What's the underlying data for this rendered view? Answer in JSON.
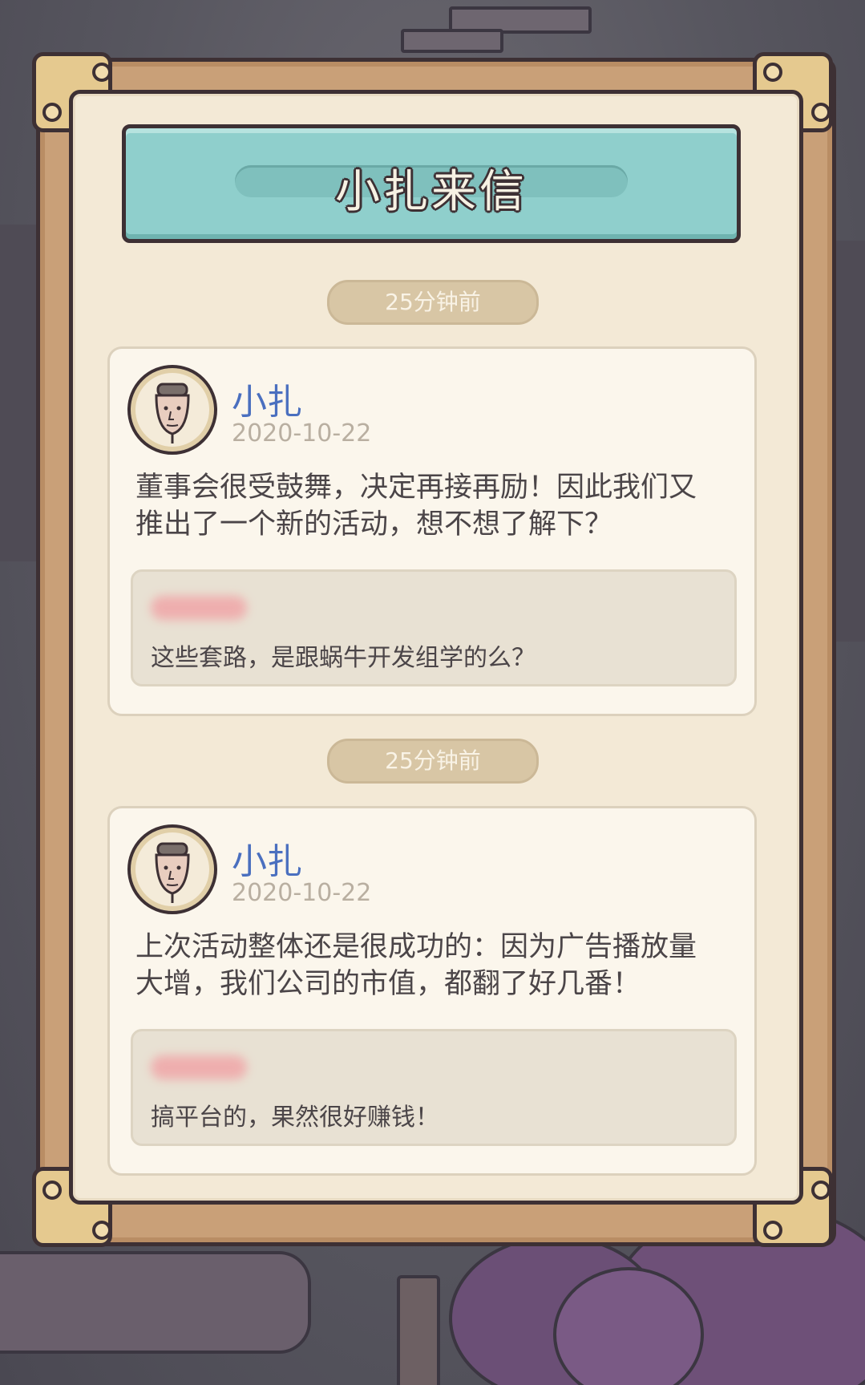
{
  "window": {
    "title": "小扎来信"
  },
  "messages": [
    {
      "time_label": "25分钟前",
      "sender": "小扎",
      "date": "2020-10-22",
      "body_line1": "董事会很受鼓舞，决定再接再励！因此我们又",
      "body_line2": "推出了一个新的活动，想不想了解下？",
      "reply": "这些套路，是跟蜗牛开发组学的么？"
    },
    {
      "time_label": "25分钟前",
      "sender": "小扎",
      "date": "2020-10-22",
      "body_line1": "上次活动整体还是很成功的：因为广告播放量",
      "body_line2": "大增，我们公司的市值，都翻了好几番！",
      "reply": "搞平台的，果然很好赚钱！"
    }
  ],
  "icons": {
    "avatar": "portrait-icon",
    "reply_name": "blurred-username"
  },
  "colors": {
    "frame": "#c9a078",
    "paper": "#f3e9d6",
    "banner": "#8fcfcc",
    "sender_name": "#4a6fbf",
    "date_text": "#b9afa1",
    "time_pill": "#d8c6a5"
  }
}
